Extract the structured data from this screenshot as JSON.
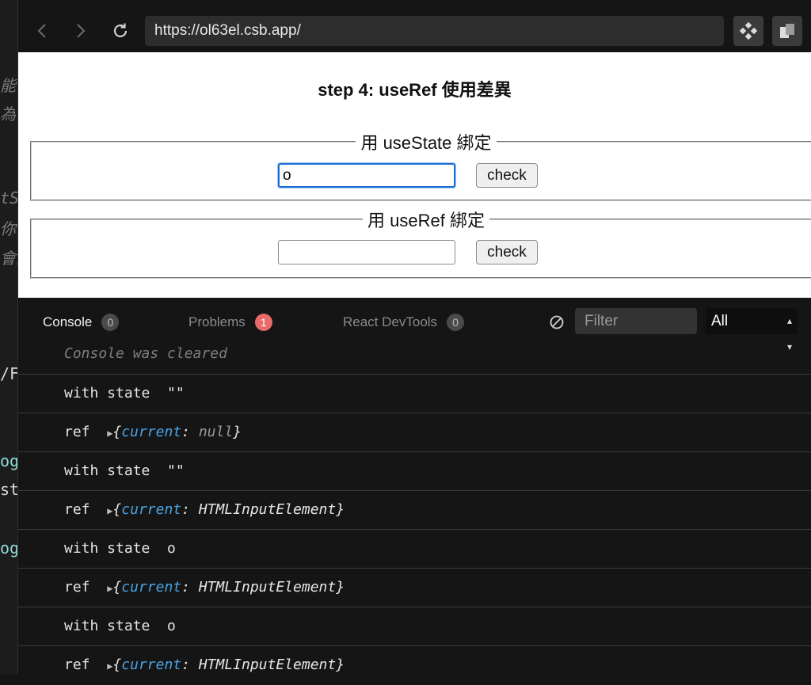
{
  "editor_strip": {
    "fragments": [
      "能",
      "為",
      "tS",
      "你就",
      "會動",
      "/F",
      "og",
      "st",
      "og"
    ]
  },
  "browser": {
    "url": "https://ol63el.csb.app/",
    "back_icon": "chevron-left-icon",
    "forward_icon": "chevron-right-icon",
    "reload_icon": "reload-icon",
    "extensions_icon": "diamond-grid-icon",
    "open_window_icon": "open-window-icon"
  },
  "page": {
    "title": "step 4: useRef 使用差異",
    "state_section": {
      "legend": "用 useState 綁定",
      "input_value": "o",
      "check_label": "check"
    },
    "ref_section": {
      "legend": "用 useRef 綁定",
      "input_value": "",
      "check_label": "check"
    }
  },
  "console": {
    "tabs": [
      {
        "label": "Console",
        "count": "0",
        "active": true
      },
      {
        "label": "Problems",
        "count": "1",
        "active": false,
        "badge_color": "#e96a6a"
      },
      {
        "label": "React DevTools",
        "count": "0",
        "active": false
      }
    ],
    "clear_icon": "clear-console-icon",
    "filter_placeholder": "Filter",
    "level": "All",
    "cleared_message": "Console was cleared",
    "logs": [
      {
        "text": "with state  \"\""
      },
      {
        "prefix": "ref  ",
        "key": "current",
        "value": "null"
      },
      {
        "text": "with state  \"\""
      },
      {
        "prefix": "ref  ",
        "key": "current",
        "value": "HTMLInputElement"
      },
      {
        "text": "with state  o"
      },
      {
        "prefix": "ref  ",
        "key": "current",
        "value": "HTMLInputElement"
      },
      {
        "text": "with state  o"
      },
      {
        "prefix": "ref  ",
        "key": "current",
        "value": "HTMLInputElement"
      }
    ],
    "colors": {
      "key": "#4aa3e6",
      "badge_error": "#e96a6a"
    }
  }
}
